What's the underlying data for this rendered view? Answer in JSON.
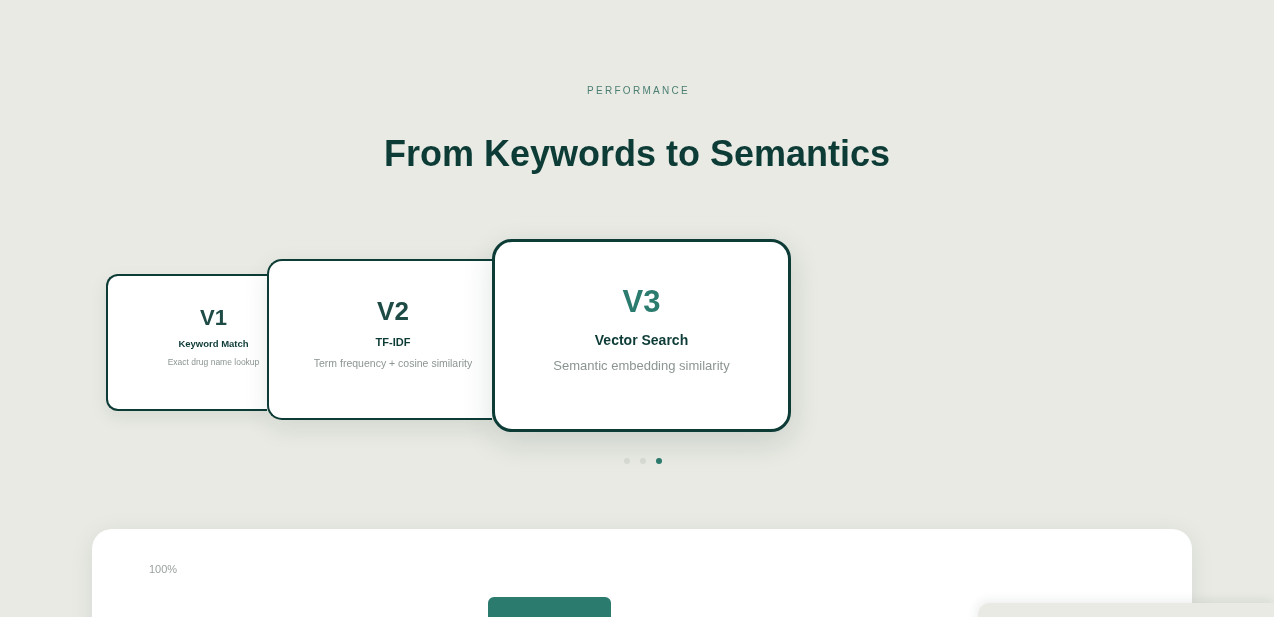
{
  "eyebrow": "PERFORMANCE",
  "title": "From Keywords to Semantics",
  "carousel": {
    "cards": [
      {
        "version": "V1",
        "name": "Keyword Match",
        "description": "Exact drug name lookup",
        "selected": false
      },
      {
        "version": "V2",
        "name": "TF-IDF",
        "description": "Term frequency + cosine similarity",
        "selected": false
      },
      {
        "version": "V3",
        "name": "Vector Search",
        "description": "Semantic embedding similarity",
        "selected": true
      }
    ],
    "dots": [
      {
        "selected": false
      },
      {
        "selected": false
      },
      {
        "selected": true
      }
    ]
  },
  "chart_panel": {
    "axis_label": "100%"
  }
}
